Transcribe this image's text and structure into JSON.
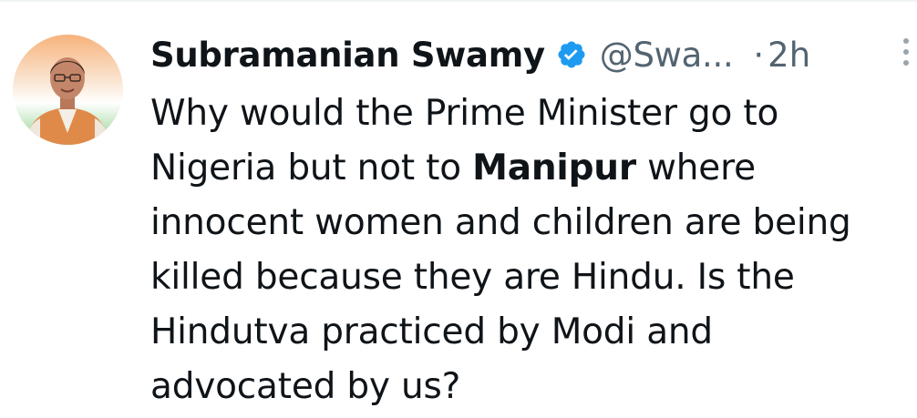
{
  "tweet": {
    "author": {
      "display_name": "Subramanian Swamy",
      "handle": "@Swa...",
      "verified_icon": "verified-badge-icon",
      "avatar": "profile-photo"
    },
    "separator": "·",
    "timestamp": "2h",
    "more_icon": "more-options-icon",
    "body": {
      "line1": "Why would the Prime Minister go to",
      "line2_pre": "Nigeria but not to ",
      "line2_bold": "Manipur",
      "line2_post": " where",
      "line3": "innocent women and children are being",
      "line4": "killed because they are Hindu. Is the",
      "line5": "Hindutva practiced by Modi and",
      "line6": "advocated by us?"
    }
  },
  "colors": {
    "text_primary": "#0f1419",
    "text_secondary": "#536471",
    "verified_blue": "#1d9bf0",
    "divider": "#eff3f4"
  }
}
